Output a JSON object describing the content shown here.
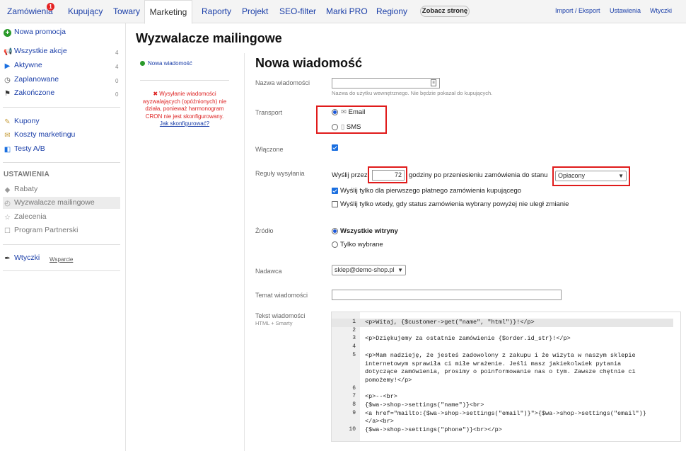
{
  "nav": {
    "tabs": [
      "Zamówienia",
      "Kupujący",
      "Towary",
      "Marketing",
      "Raporty",
      "Projekt",
      "SEO-filter",
      "Marki PRO",
      "Regiony"
    ],
    "badge": "1",
    "see_store": "Zobacz stronę",
    "right": [
      "Import / Eksport",
      "Ustawienia",
      "Wtyczki"
    ]
  },
  "sidebar": {
    "new_promo": "Nowa promocja",
    "items": [
      {
        "label": "Wszystkie akcje",
        "count": "4",
        "icon": "megaphone-icon"
      },
      {
        "label": "Aktywne",
        "count": "4",
        "icon": "play-icon"
      },
      {
        "label": "Zaplanowane",
        "count": "0",
        "icon": "clock-icon"
      },
      {
        "label": "Zakończone",
        "count": "0",
        "icon": "flag-icon"
      }
    ],
    "items2": [
      {
        "label": "Kupony",
        "icon": "coupon-icon"
      },
      {
        "label": "Koszty marketingu",
        "icon": "money-icon"
      },
      {
        "label": "Testy A/B",
        "icon": "ab-icon"
      }
    ],
    "settings_heading": "USTAWIENIA",
    "settings": [
      {
        "label": "Rabaty",
        "icon": "tag-icon"
      },
      {
        "label": "Wyzwalacze mailingowe",
        "icon": "timer-icon"
      },
      {
        "label": "Zalecenia",
        "icon": "star-icon"
      },
      {
        "label": "Program Partnerski",
        "icon": "partner-icon"
      }
    ],
    "plugins": "Wtyczki",
    "support": "Wsparcie"
  },
  "page_title": "Wyzwalacze mailingowe",
  "subnav": {
    "new_message": "Nowa wiadomość"
  },
  "warning": {
    "text": "Wysyłanie wiadomości wyzwalających (opóźnionych) nie działa, ponieważ harmonogram CRON nie jest skonfigurowany.",
    "link": "Jak skonfigurować?"
  },
  "form": {
    "title": "Nowa wiadomość",
    "name_label": "Nazwa wiadomości",
    "name_value": "",
    "name_hint": "Nazwa do użytku wewnętrznego. Nie będzie pokazał do kupujących.",
    "transport_label": "Transport",
    "transport_email": "Email",
    "transport_sms": "SMS",
    "transport_selected": "email",
    "enabled_label": "Włączone",
    "enabled": true,
    "rules_label": "Reguły wysyłania",
    "rules_prefix": "Wyślij przez",
    "rules_hours": "72",
    "rules_middle": "godziny po przeniesieniu zamówienia do stanu",
    "rules_status": "Opłacony",
    "rule_first": "Wyślij tylko dla pierwszego płatnego zamówienia kupującego",
    "rule_first_checked": true,
    "rule_unchanged": "Wyślij tylko wtedy, gdy status zamówienia wybrany powyżej nie uległ zmianie",
    "rule_unchanged_checked": false,
    "source_label": "Źródło",
    "source_all": "Wszystkie witryny",
    "source_selected_opt": "Tylko wybrane",
    "source_selected": "all",
    "sender_label": "Nadawca",
    "sender_value": "sklep@demo-shop.pl",
    "subject_label": "Temat wiadomości",
    "subject_value": "",
    "body_label": "Tekst wiadomości",
    "body_sub": "HTML + Smarty"
  },
  "code": {
    "line_numbers": [
      "1",
      "2",
      "3",
      "4",
      "5",
      "",
      "",
      "",
      "6",
      "7",
      "8",
      "9",
      "",
      "10"
    ],
    "lines": [
      "<p>Witaj, {$customer->get(\"name\", \"html\")}!</p>",
      "",
      "<p>Dziękujemy za ostatnie zamówienie {$order.id_str}!</p>",
      "",
      "<p>Mam nadzieję, że jesteś zadowolony z zakupu i że wizyta w naszym sklepie",
      "    internetowym sprawiła ci miłe wrażenie. Jeśli masz jakiekolwiek pytania",
      "    dotyczące zamówienia, prosimy o poinformowanie nas o tym. Zawsze chętnie ci",
      "    pomożemy!</p>",
      "",
      "<p>--<br>",
      "{$wa->shop->settings(\"name\")}<br>",
      "<a href=\"mailto:{$wa->shop->settings(\"email\")}\">{$wa->shop->settings(\"email\")}",
      "    </a><br>",
      "{$wa->shop->settings(\"phone\")}<br></p>"
    ]
  }
}
